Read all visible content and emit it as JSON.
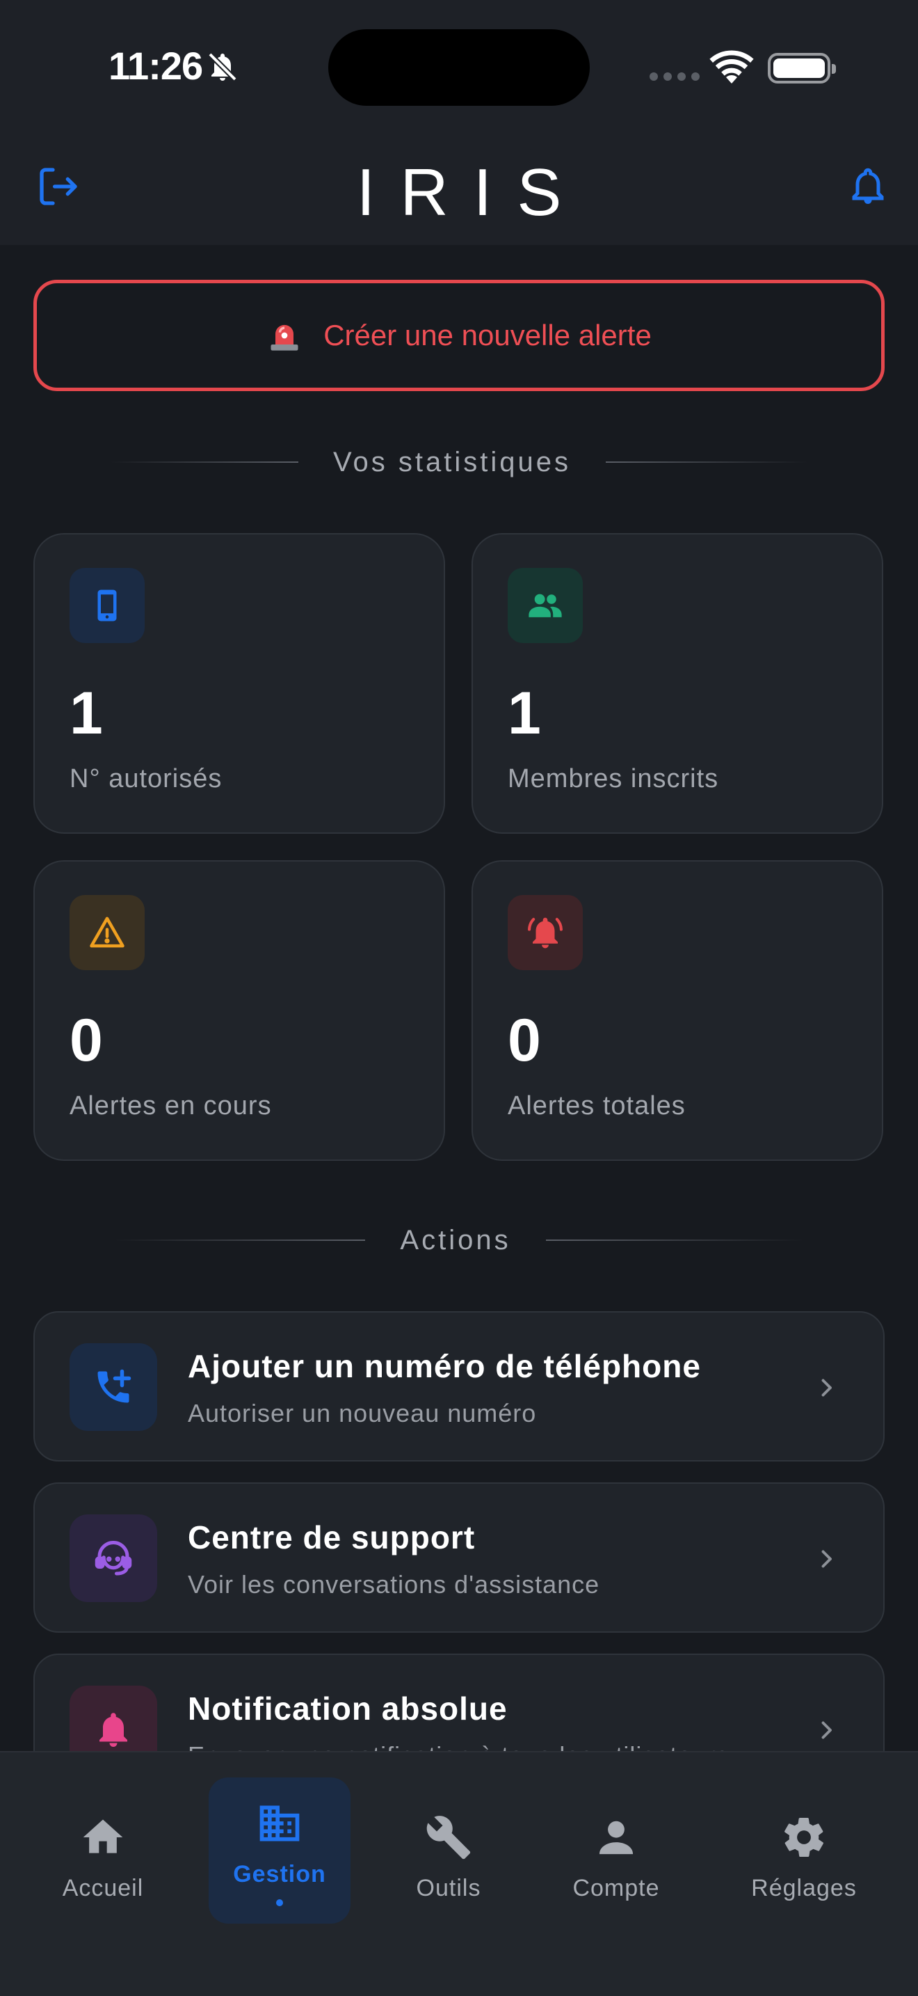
{
  "status_bar": {
    "time": "11:26"
  },
  "header": {
    "title": "IRIS"
  },
  "alert_button": {
    "label": "Créer une nouvelle alerte"
  },
  "stats_section": {
    "title": "Vos statistiques"
  },
  "stats": [
    {
      "value": "1",
      "label": "N° autorisés",
      "icon": "smartphone-icon",
      "color": "#1f73f0"
    },
    {
      "value": "1",
      "label": "Membres inscrits",
      "icon": "group-icon",
      "color": "#22b07d"
    },
    {
      "value": "0",
      "label": "Alertes en cours",
      "icon": "warning-icon",
      "color": "#f0a020"
    },
    {
      "value": "0",
      "label": "Alertes totales",
      "icon": "ringing-bell-icon",
      "color": "#e5484d"
    }
  ],
  "actions_section": {
    "title": "Actions"
  },
  "actions": [
    {
      "title": "Ajouter un numéro de téléphone",
      "subtitle": "Autoriser un nouveau numéro",
      "icon": "phone-add-icon",
      "color": "#1f73f0"
    },
    {
      "title": "Centre de support",
      "subtitle": "Voir les conversations d'assistance",
      "icon": "support-agent-icon",
      "color": "#9b5de5"
    },
    {
      "title": "Notification absolue",
      "subtitle": "Envoyer une notification à tous les utilisateurs",
      "icon": "bell-icon",
      "color": "#e8458b"
    }
  ],
  "bottom_nav": {
    "items": [
      {
        "label": "Accueil",
        "icon": "home-icon",
        "active": false
      },
      {
        "label": "Gestion",
        "icon": "building-icon",
        "active": true
      },
      {
        "label": "Outils",
        "icon": "wrench-icon",
        "active": false
      },
      {
        "label": "Compte",
        "icon": "person-icon",
        "active": false
      },
      {
        "label": "Réglages",
        "icon": "gear-icon",
        "active": false
      }
    ]
  },
  "colors": {
    "accent": "#1f73f0",
    "danger": "#e5484d",
    "background": "#171a1f"
  }
}
